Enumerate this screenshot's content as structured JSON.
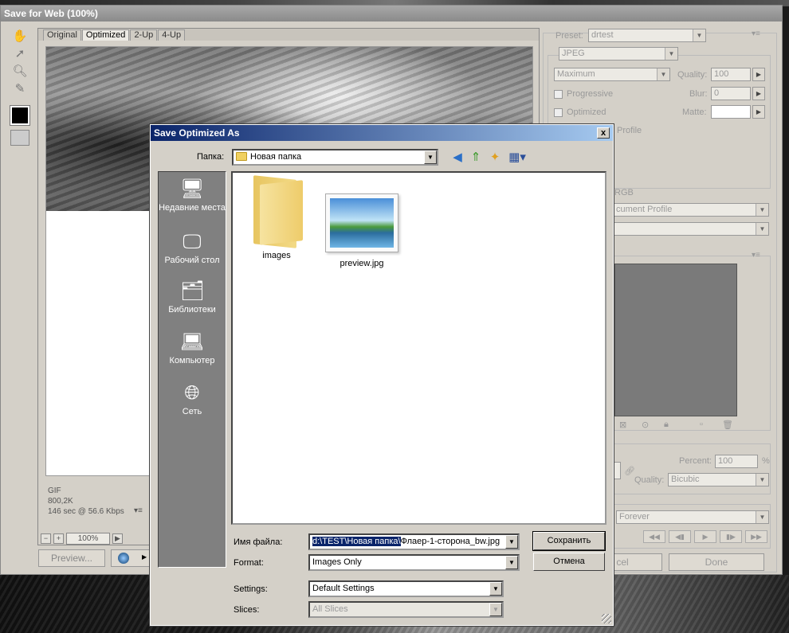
{
  "sfw": {
    "title": "Save for Web (100%)",
    "tabs": [
      "Original",
      "Optimized",
      "2-Up",
      "4-Up"
    ],
    "active_tab": "Optimized",
    "info_format": "GIF",
    "info_size": "800,2K",
    "info_time": "146 sec @ 56.6 Kbps",
    "info_menu": "▾≡",
    "zoom": "100%",
    "preview_label": "Preview...",
    "right": {
      "preset_label": "Preset:",
      "preset_value": "drtest",
      "format_value": "JPEG",
      "quality_preset": "Maximum",
      "quality_label": "Quality:",
      "quality_value": "100",
      "progressive_label": "Progressive",
      "blur_label": "Blur:",
      "blur_value": "0",
      "optimized_label": "Optimized",
      "matte_label": "Matte:",
      "profile_label": "Profile",
      "rgb_label": "RGB",
      "document_profile": "cument Profile",
      "percent_label": "Percent:",
      "percent_value": "100",
      "percent_unit": "%",
      "resample_label": "Quality:",
      "resample_value": "Bicubic",
      "loop_value": "Forever",
      "cancel_label": "cel",
      "done_label": "Done"
    }
  },
  "dialog": {
    "title": "Save Optimized As",
    "folder_label": "Папка:",
    "folder_value": "Новая папка",
    "places": [
      "Недавние места",
      "Рабочий стол",
      "Библиотеки",
      "Компьютер",
      "Сеть"
    ],
    "files": [
      "images",
      "preview.jpg"
    ],
    "filename_label": "Имя файла:",
    "filename_selected": "d:\\TEST\\Новая папка\\",
    "filename_rest": "Флаер-1-сторона_bw.jpg",
    "format_label": "Format:",
    "format_value": "Images Only",
    "settings_label": "Settings:",
    "settings_value": "Default Settings",
    "slices_label": "Slices:",
    "slices_value": "All Slices",
    "save_label": "Сохранить",
    "cancel_label": "Отмена",
    "close_glyph": "x"
  }
}
